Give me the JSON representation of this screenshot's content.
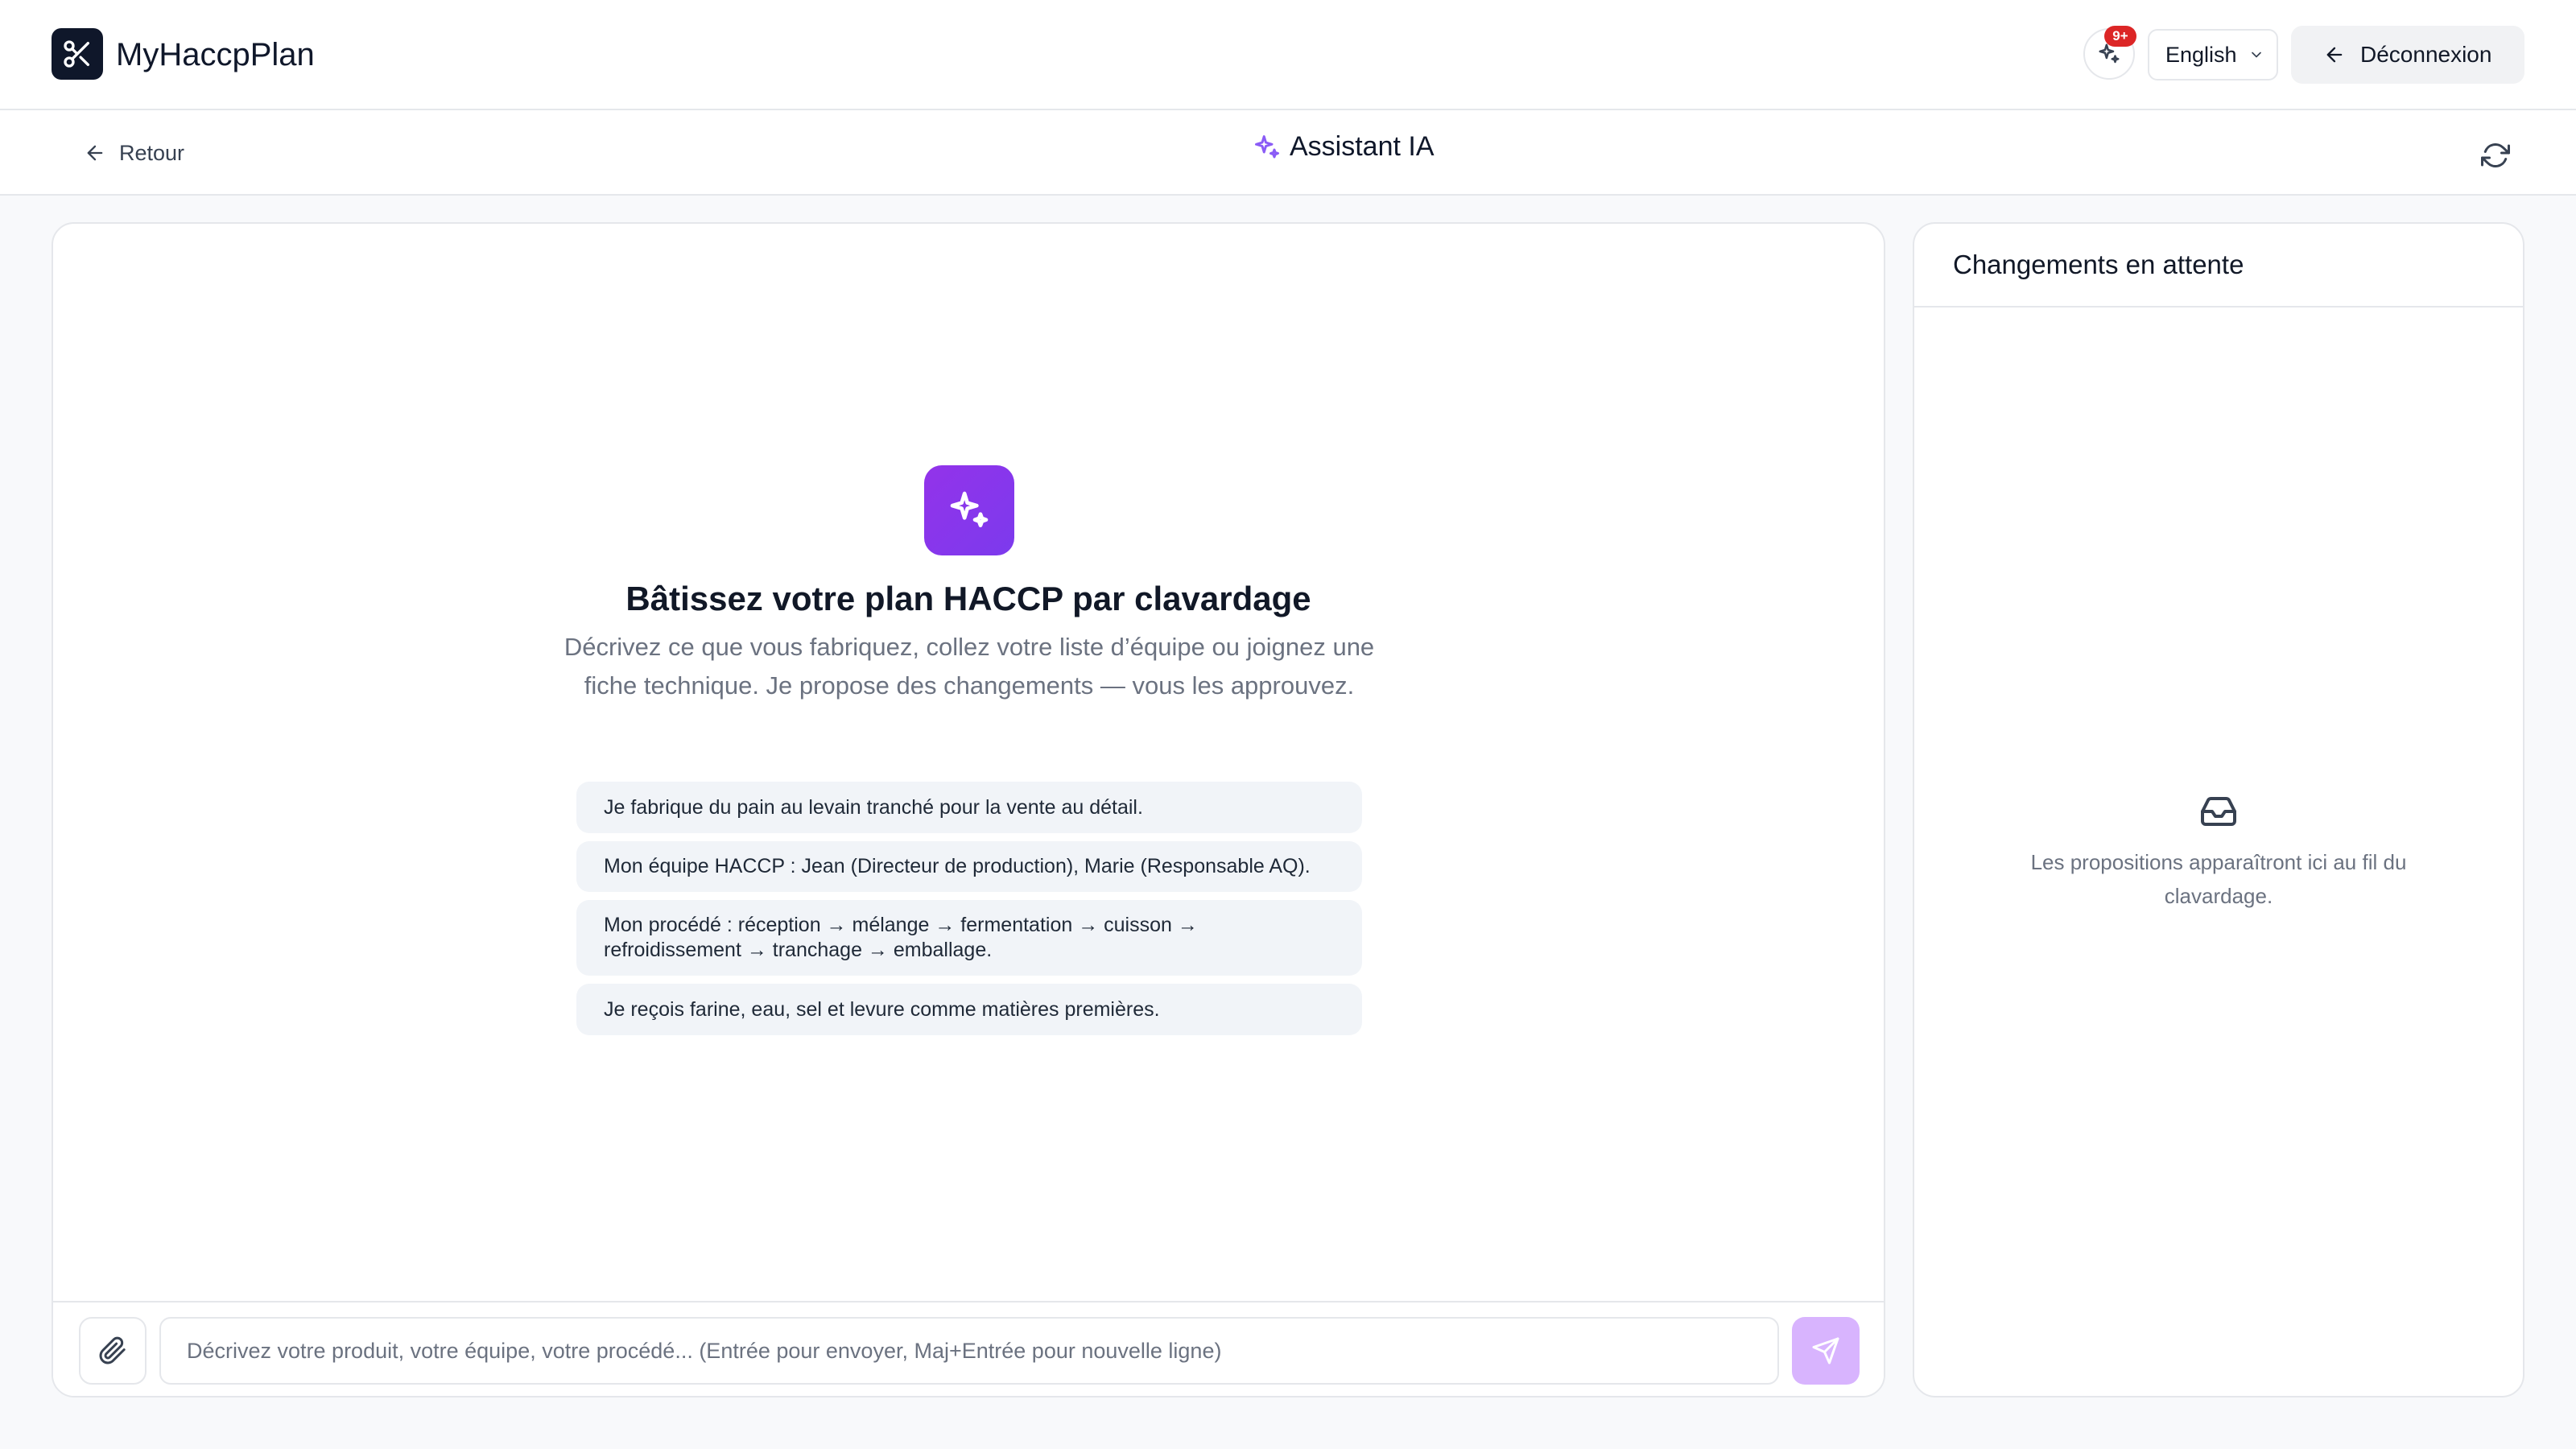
{
  "app": {
    "title": "MyHaccpPlan",
    "notification_count": "9+",
    "language": "English",
    "logout_label": "Déconnexion"
  },
  "subheader": {
    "back_label": "Retour",
    "title": "Assistant IA"
  },
  "chat": {
    "hero_title": "Bâtissez votre plan HACCP par clavardage",
    "hero_subtitle": "Décrivez ce que vous fabriquez, collez votre liste d’équipe ou joignez une fiche technique. Je propose des changements — vous les approuvez.",
    "suggestions": [
      "Je fabrique du pain au levain tranché pour la vente au détail.",
      "Mon équipe HACCP : Jean (Directeur de production), Marie (Responsable AQ).",
      "Mon procédé : réception → mélange → fermentation → cuisson → refroidissement → tranchage → emballage.",
      "Je reçois farine, eau, sel et levure comme matières premières."
    ],
    "input_placeholder": "Décrivez votre produit, votre équipe, votre procédé... (Entrée pour envoyer, Maj+Entrée pour nouvelle ligne)"
  },
  "pending": {
    "title": "Changements en attente",
    "empty_text": "Les propositions apparaîtront ici au fil du clavardage."
  },
  "colors": {
    "accent": "#7c3aed",
    "send_disabled": "#d8b4fe",
    "badge": "#dc2626"
  }
}
